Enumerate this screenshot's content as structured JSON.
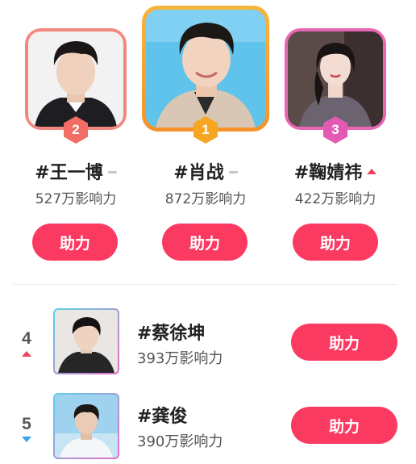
{
  "colors": {
    "accent": "#fb3a62",
    "gold": "#f6a623",
    "rank2": "#f26d66",
    "rank3": "#e35ab4",
    "trend_up": "#f2415e",
    "trend_down": "#3aa3e8",
    "trend_flat": "#c8c8c8"
  },
  "boost_label": "助力",
  "podium": [
    {
      "rank": "2",
      "name": "#王一博",
      "influence": "527万影响力",
      "trend": "flat"
    },
    {
      "rank": "1",
      "name": "#肖战",
      "influence": "872万影响力",
      "trend": "flat"
    },
    {
      "rank": "3",
      "name": "#鞠婧祎",
      "influence": "422万影响力",
      "trend": "up"
    }
  ],
  "list": [
    {
      "rank": "4",
      "name": "#蔡徐坤",
      "influence": "393万影响力",
      "trend": "up"
    },
    {
      "rank": "5",
      "name": "#龚俊",
      "influence": "390万影响力",
      "trend": "down"
    }
  ]
}
